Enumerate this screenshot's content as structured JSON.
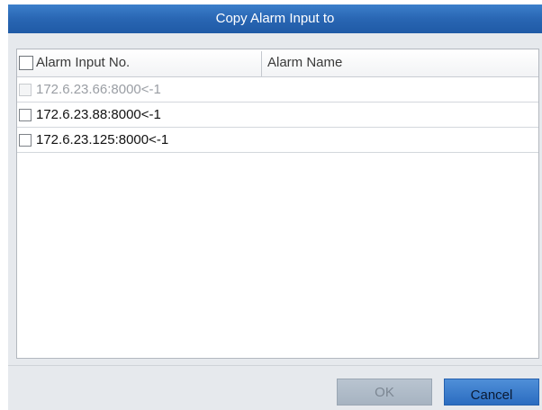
{
  "dialog": {
    "title": "Copy Alarm Input to"
  },
  "table": {
    "columns": [
      "Alarm Input No.",
      "Alarm Name"
    ],
    "rows": [
      {
        "input_no": "172.6.23.66:8000<-1",
        "name": "",
        "disabled": true
      },
      {
        "input_no": "172.6.23.88:8000<-1",
        "name": "",
        "disabled": false
      },
      {
        "input_no": "172.6.23.125:8000<-1",
        "name": "",
        "disabled": false
      }
    ]
  },
  "buttons": {
    "ok_label": "OK",
    "cancel_label": "Cancel"
  },
  "colors": {
    "title_bar": "#2966b3",
    "cancel_button": "#2b6cc0",
    "ok_button_disabled": "#a6b3c1"
  }
}
